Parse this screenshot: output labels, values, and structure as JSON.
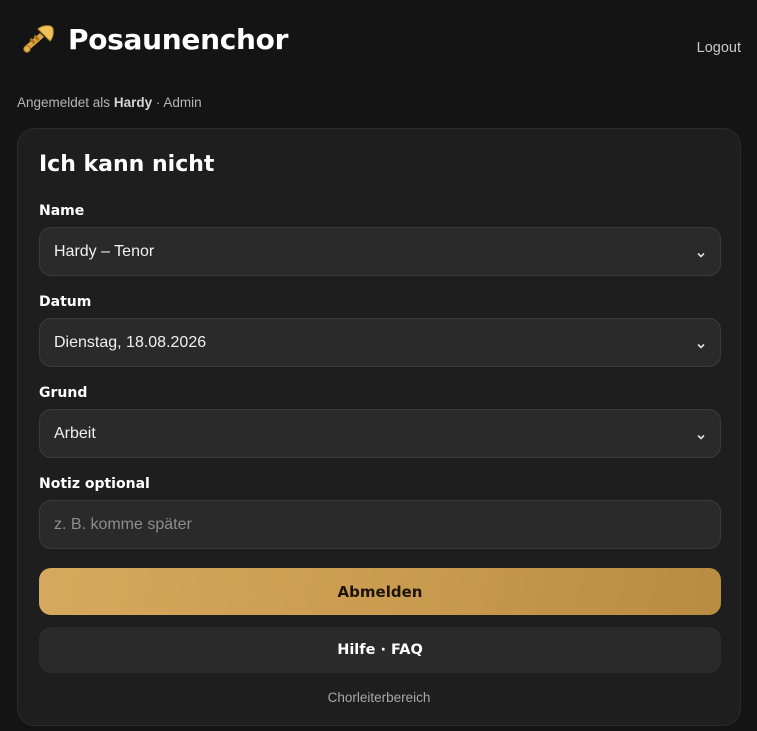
{
  "header": {
    "title": "Posaunenchor",
    "logo_icon": "trumpet-icon",
    "logout_label": "Logout"
  },
  "session": {
    "prefix": "Angemeldet als",
    "user": "Hardy",
    "role_text": "· Admin"
  },
  "form": {
    "title": "Ich kann nicht",
    "name": {
      "label": "Name",
      "value": "Hardy – Tenor"
    },
    "date": {
      "label": "Datum",
      "value": "Dienstag, 18.08.2026"
    },
    "reason": {
      "label": "Grund",
      "value": "Arbeit"
    },
    "note": {
      "label": "Notiz optional",
      "value": "",
      "placeholder": "z. B. komme später"
    },
    "submit_label": "Abmelden",
    "help_label": "Hilfe · FAQ",
    "leader_link": "Chorleiterbereich"
  },
  "colors": {
    "background": "#141414",
    "card": "#1e1e1e",
    "accent_gold": "#cfa25a",
    "field": "#2a2a2a"
  }
}
